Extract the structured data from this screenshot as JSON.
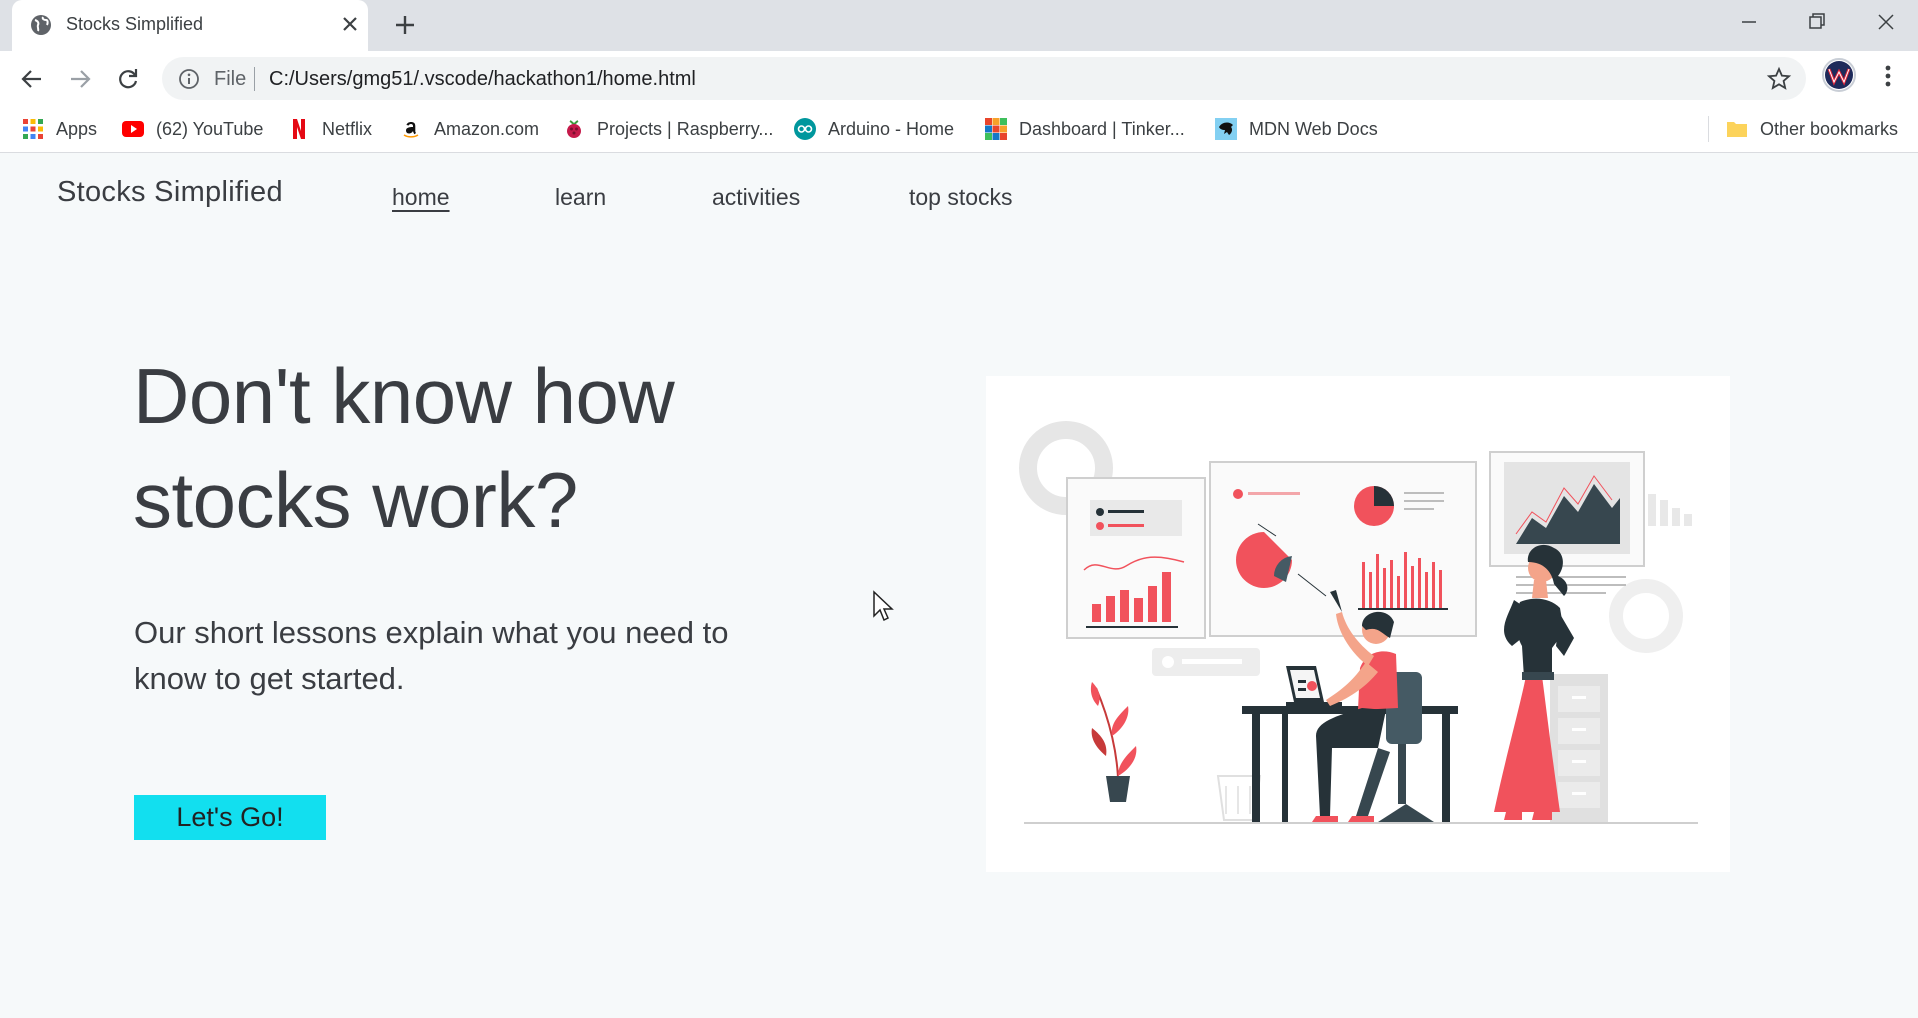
{
  "browser": {
    "tab_title": "Stocks Simplified",
    "omnibox": {
      "scheme_label": "File",
      "url": "C:/Users/gmg51/.vscode/hackathon1/home.html"
    },
    "bookmarks": [
      {
        "label": "Apps",
        "icon": "apps-grid-icon"
      },
      {
        "label": "(62) YouTube",
        "icon": "youtube-icon"
      },
      {
        "label": "Netflix",
        "icon": "netflix-icon"
      },
      {
        "label": "Amazon.com",
        "icon": "amazon-icon"
      },
      {
        "label": "Projects | Raspberry...",
        "icon": "raspberry-icon"
      },
      {
        "label": "Arduino - Home",
        "icon": "arduino-icon"
      },
      {
        "label": "Dashboard | Tinker...",
        "icon": "tinkercad-icon"
      },
      {
        "label": "MDN Web Docs",
        "icon": "mdn-icon"
      }
    ],
    "other_bookmarks": "Other bookmarks"
  },
  "site": {
    "brand": "Stocks Simplified",
    "nav": [
      {
        "label": "home",
        "active": true
      },
      {
        "label": "learn",
        "active": false
      },
      {
        "label": "activities",
        "active": false
      },
      {
        "label": "top stocks",
        "active": false
      }
    ],
    "hero": {
      "title_line1": "Don't know how",
      "title_line2": "stocks work?",
      "subtitle_line1": "Our short lessons explain what you need to",
      "subtitle_line2": "know to get started.",
      "cta_label": "Let's Go!"
    }
  },
  "colors": {
    "cta": "#12dfef",
    "accent_red": "#f1525c",
    "dark": "#263238",
    "page_bg": "#f6f9fa"
  }
}
